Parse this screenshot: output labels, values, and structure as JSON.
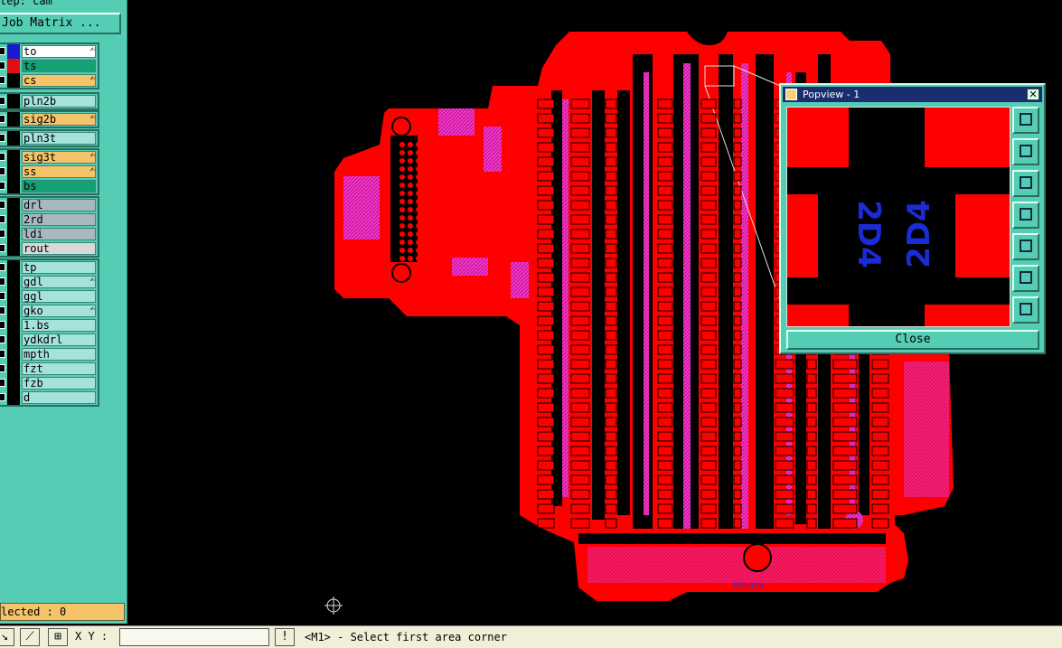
{
  "panel": {
    "step_label": "tep: cam",
    "job_matrix_button": "Job Matrix ...",
    "selected_text": "lected : 0",
    "groups": [
      {
        "layers": [
          {
            "name": "to",
            "bg": "#ffffff",
            "swatch": "#1a1acc",
            "edit": true
          },
          {
            "name": "ts",
            "bg": "#14a173",
            "swatch": "#e01010",
            "edit": false
          },
          {
            "name": "cs",
            "bg": "#f5c36a",
            "swatch": "#000000",
            "edit": true
          }
        ]
      },
      {
        "layers": [
          {
            "name": "pln2b",
            "bg": "#a6e2dc",
            "swatch": "#000000",
            "edit": false
          }
        ]
      },
      {
        "layers": [
          {
            "name": "sig2b",
            "bg": "#f5c36a",
            "swatch": "#000000",
            "edit": true
          }
        ]
      },
      {
        "layers": [
          {
            "name": "pln3t",
            "bg": "#a6e2dc",
            "swatch": "#000000",
            "edit": false
          }
        ]
      },
      {
        "layers": [
          {
            "name": "sig3t",
            "bg": "#f5c36a",
            "swatch": "#000000",
            "edit": true
          },
          {
            "name": "ss",
            "bg": "#f5c36a",
            "swatch": "#000000",
            "edit": true
          },
          {
            "name": "bs",
            "bg": "#14a173",
            "swatch": "#000000",
            "edit": false
          }
        ]
      },
      {
        "layers": [
          {
            "name": "drl",
            "bg": "#a8b8c0",
            "swatch": "#000000",
            "edit": false
          },
          {
            "name": "2rd",
            "bg": "#a8b8c0",
            "swatch": "#000000",
            "edit": false
          },
          {
            "name": "ldi",
            "bg": "#a8b8c0",
            "swatch": "#000000",
            "edit": false
          },
          {
            "name": "rout",
            "bg": "#d8d8d8",
            "swatch": "#000000",
            "edit": false
          }
        ]
      },
      {
        "layers": [
          {
            "name": "tp",
            "bg": "#a6e2dc",
            "swatch": "#000000",
            "edit": false
          },
          {
            "name": "gdl",
            "bg": "#a6e2dc",
            "swatch": "#000000",
            "edit": true
          },
          {
            "name": "ggl",
            "bg": "#a6e2dc",
            "swatch": "#000000",
            "edit": false
          },
          {
            "name": "gko",
            "bg": "#a6e2dc",
            "swatch": "#000000",
            "edit": true
          },
          {
            "name": "1.bs",
            "bg": "#a6e2dc",
            "swatch": "#000000",
            "edit": false
          },
          {
            "name": "ydkdrl",
            "bg": "#a6e2dc",
            "swatch": "#000000",
            "edit": false
          },
          {
            "name": "mpth",
            "bg": "#a6e2dc",
            "swatch": "#000000",
            "edit": false
          },
          {
            "name": "fzt",
            "bg": "#a6e2dc",
            "swatch": "#000000",
            "edit": false
          },
          {
            "name": "fzb",
            "bg": "#a6e2dc",
            "swatch": "#000000",
            "edit": false
          },
          {
            "name": "d",
            "bg": "#a6e2dc",
            "swatch": "#000000",
            "edit": false
          }
        ]
      }
    ]
  },
  "popview": {
    "title": "Popview - 1",
    "close_label": "Close",
    "labels": [
      "2D4",
      "2D4"
    ],
    "tools": [
      "zoom-window-icon",
      "zoom-up-icon",
      "zoom-down-icon",
      "pan-left-icon",
      "pan-right-icon",
      "zoom-fit-icon",
      "zoom-home-icon"
    ]
  },
  "board": {
    "silk_label": "MYL028"
  },
  "statusbar": {
    "xy_label": "X Y :",
    "xy_value": "",
    "message": "<M1> - Select first area corner",
    "alert_glyph": "!"
  },
  "colors": {
    "copper": "#ff0000",
    "pad_hatch": "#ff33cc",
    "silk": "#2030e0",
    "panel": "#55cdb4"
  }
}
